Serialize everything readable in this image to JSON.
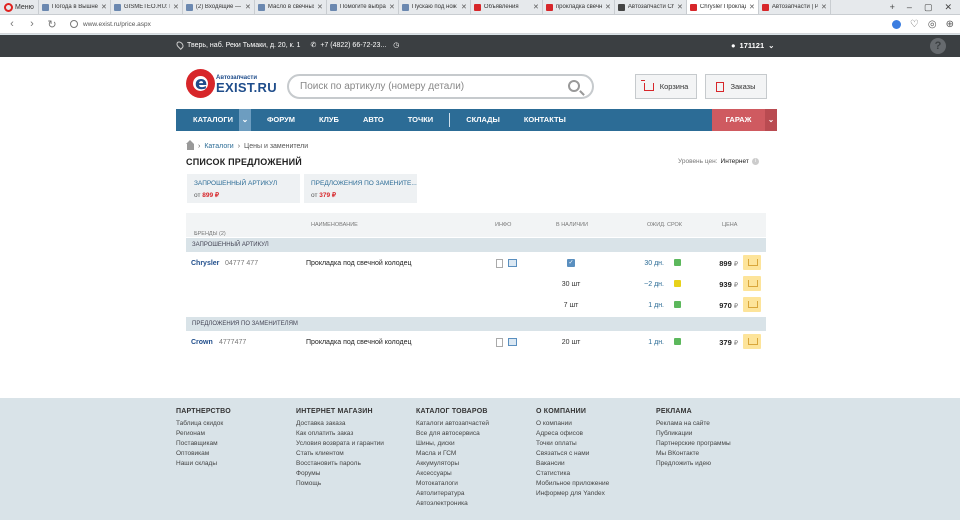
{
  "browser": {
    "menu_label": "Меню",
    "tabs": [
      {
        "label": "Погода в Вышне"
      },
      {
        "label": "GISMETEO.RU: По"
      },
      {
        "label": "(2) Входящие — Y"
      },
      {
        "label": "Масло в свечных"
      },
      {
        "label": "Помогите выбра"
      },
      {
        "label": "Пускаю под нож"
      },
      {
        "label": "Объявления"
      },
      {
        "label": "прокладка свечн"
      },
      {
        "label": "Автозапчасти Ch"
      },
      {
        "label": "Chrysler Проклад",
        "active": true
      },
      {
        "label": "Автозапчасти | Р"
      }
    ],
    "url": "www.exist.ru/price.aspx",
    "back": "‹",
    "forward": "›",
    "reload": "↻",
    "new_tab": "+",
    "win_min": "–",
    "win_max": "▢",
    "win_close": "✕"
  },
  "topbar": {
    "address": "Тверь, наб. Реки Тьмаки, д. 20, к. 1",
    "phone": "+7 (4822) 66-72-23...",
    "user": "171121",
    "help": "?"
  },
  "logo": {
    "small": "Автозапчасти",
    "big": "EXIST.RU"
  },
  "search": {
    "placeholder": "Поиск по артикулу (номеру детали)"
  },
  "header_buttons": {
    "cart": "Корзина",
    "orders": "Заказы"
  },
  "nav": {
    "items": [
      "КАТАЛОГИ",
      "ФОРУМ",
      "КЛУБ",
      "АВТО",
      "ТОЧКИ",
      "СКЛАДЫ",
      "КОНТАКТЫ"
    ],
    "garage": "ГАРАЖ"
  },
  "breadcrumb": {
    "catalogs": "Каталоги",
    "current": "Цены и заменители"
  },
  "page": {
    "title": "СПИСОК ПРЕДЛОЖЕНИЙ",
    "price_level_label": "Уровень цен:",
    "price_level_value": "Интернет"
  },
  "summary": [
    {
      "title": "ЗАПРОШЕННЫЙ АРТИКУЛ",
      "from": "от",
      "price": "899 ₽"
    },
    {
      "title": "ПРЕДЛОЖЕНИЯ ПО ЗАМЕНИТЕ...",
      "from": "от",
      "price": "379 ₽"
    }
  ],
  "table": {
    "headers": {
      "brands": "БРЕНДЫ (2)",
      "name": "НАИМЕНОВАНИЕ",
      "info": "ИНФО",
      "stock": "В НАЛИЧИИ",
      "term": "ОЖИД. СРОК",
      "price": "ЦЕНА"
    },
    "group_requested": "ЗАПРОШЕННЫЙ АРТИКУЛ",
    "group_replacements": "ПРЕДЛОЖЕНИЯ ПО ЗАМЕНИТЕЛЯМ",
    "rows": [
      {
        "brand": "Chrysler",
        "article": "04777 477",
        "name": "Прокладка под свечной колодец",
        "stock": "",
        "term": "30 дн.",
        "status": "#5cb85c",
        "price": "899",
        "currency": "₽"
      },
      {
        "brand": "",
        "article": "",
        "name": "",
        "stock": "30 шт",
        "term": "~2 дн.",
        "status": "#e8d21a",
        "price": "939",
        "currency": "₽"
      },
      {
        "brand": "",
        "article": "",
        "name": "",
        "stock": "7 шт",
        "term": "1 дн.",
        "status": "#5cb85c",
        "price": "970",
        "currency": "₽"
      },
      {
        "brand": "Crown",
        "article": "4777477",
        "name": "Прокладка под свечной колодец",
        "stock": "20 шт",
        "term": "1 дн.",
        "status": "#5cb85c",
        "price": "379",
        "currency": "₽"
      }
    ]
  },
  "footer": [
    {
      "title": "ПАРТНЕРСТВО",
      "links": [
        "Таблица скидок",
        "Регионам",
        "Поставщикам",
        "Оптовикам",
        "Наши склады"
      ]
    },
    {
      "title": "ИНТЕРНЕТ МАГАЗИН",
      "links": [
        "Доставка заказа",
        "Как оплатить заказ",
        "Условия возврата и гарантии",
        "Стать клиентом",
        "Восстановить пароль",
        "Форумы",
        "Помощь"
      ]
    },
    {
      "title": "КАТАЛОГ ТОВАРОВ",
      "links": [
        "Каталоги автозапчастей",
        "Все для автосервиса",
        "Шины, диски",
        "Масла и ГСМ",
        "Аккумуляторы",
        "Аксессуары",
        "Мотокаталоги",
        "Автолитература",
        "Автоэлектроника"
      ]
    },
    {
      "title": "О КОМПАНИИ",
      "links": [
        "О компании",
        "Адреса офисов",
        "Точки оплаты",
        "Связаться с нами",
        "Вакансии",
        "Статистика",
        "Мобильное приложение",
        "Информер для Yandex"
      ]
    },
    {
      "title": "РЕКЛАМА",
      "links": [
        "Реклама на сайте",
        "Публикации",
        "Партнерские программы",
        "Мы ВКонтакте",
        "Предложить идею"
      ]
    }
  ]
}
